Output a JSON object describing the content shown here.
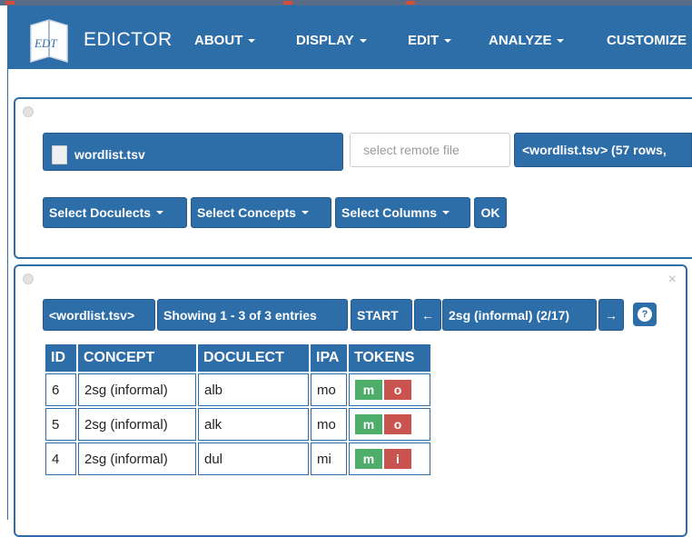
{
  "navbar": {
    "brand": "EDICTOR",
    "logo_text": "EDT",
    "items": [
      "ABOUT",
      "DISPLAY",
      "EDIT",
      "ANALYZE",
      "CUSTOMIZE"
    ]
  },
  "file_panel": {
    "file_button": "wordlist.tsv",
    "remote_placeholder": "select remote file",
    "file_status": "<wordlist.tsv> (57 rows,",
    "select_doculects": "Select Doculects",
    "select_concepts": "Select Concepts",
    "select_columns": "Select Columns",
    "ok": "OK"
  },
  "wordlist_panel": {
    "file_tag": "<wordlist.tsv>",
    "showing": "Showing 1 - 3 of 3 entries",
    "start": "START",
    "prev": "←",
    "concept_nav": "2sg (informal) (2/17)",
    "next": "→",
    "help": "?",
    "close": "×",
    "columns": [
      "ID",
      "CONCEPT",
      "DOCULECT",
      "IPA",
      "TOKENS"
    ],
    "rows": [
      {
        "id": "6",
        "concept": "2sg (informal)",
        "doculect": "alb",
        "ipa": "mo",
        "tokens": [
          "m",
          "o"
        ]
      },
      {
        "id": "5",
        "concept": "2sg (informal)",
        "doculect": "alk",
        "ipa": "mo",
        "tokens": [
          "m",
          "o"
        ]
      },
      {
        "id": "4",
        "concept": "2sg (informal)",
        "doculect": "dul",
        "ipa": "mi",
        "tokens": [
          "m",
          "i"
        ]
      }
    ]
  },
  "colors": {
    "primary": "#2d6da8",
    "token_consonant": "#4cae68",
    "token_vowel": "#c9534e"
  }
}
